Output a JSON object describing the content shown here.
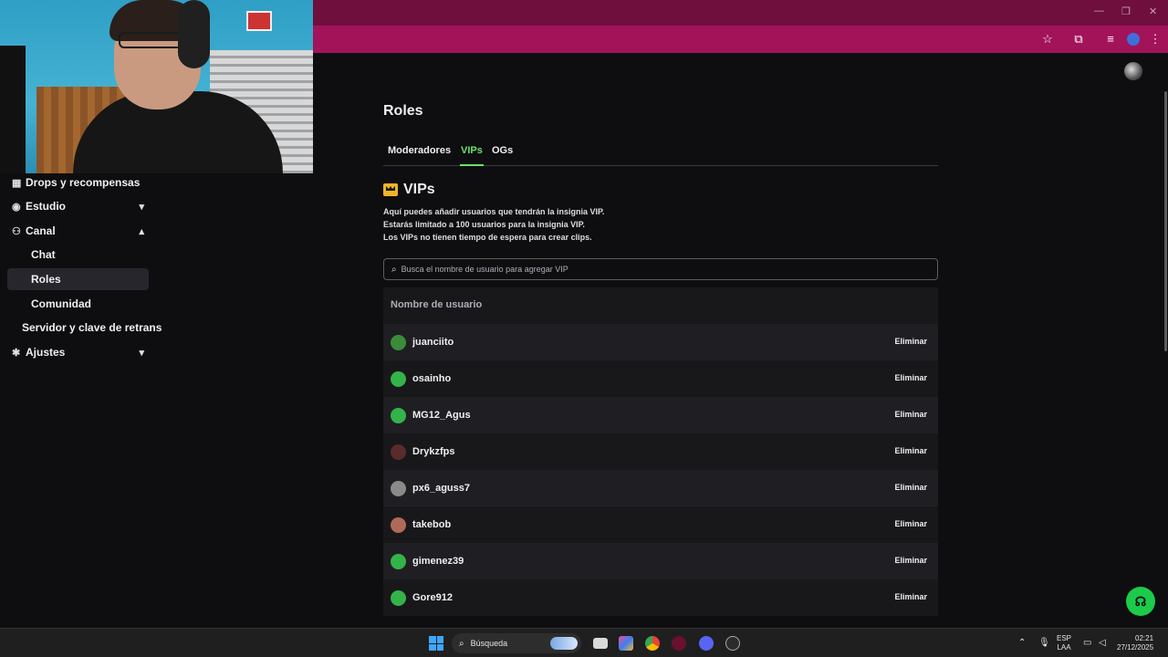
{
  "browser": {
    "window_controls": [
      "—",
      "❐",
      "✕"
    ],
    "toolbar_icons": [
      "bookmark-star-icon",
      "extensions-icon",
      "media-queue-icon",
      "profile-avatar-icon",
      "menu-dots-icon"
    ]
  },
  "sidebar": {
    "items": [
      {
        "label": "Drops y recompensas",
        "icon": "gift-icon",
        "chevron": ""
      },
      {
        "label": "Estudio",
        "icon": "studio-icon",
        "chevron": "⌄"
      },
      {
        "label": "Canal",
        "icon": "people-icon",
        "chevron": "⌃"
      },
      {
        "label": "Chat",
        "icon": "",
        "chevron": ""
      },
      {
        "label": "Roles",
        "icon": "",
        "chevron": "",
        "active": true
      },
      {
        "label": "Comunidad",
        "icon": "",
        "chevron": ""
      },
      {
        "label": "Servidor y clave de retrans",
        "icon": "",
        "chevron": ""
      },
      {
        "label": "Ajustes",
        "icon": "gear-icon",
        "chevron": "⌄"
      }
    ]
  },
  "main": {
    "title": "Roles",
    "tabs": [
      {
        "label": "Moderadores",
        "active": false
      },
      {
        "label": "VIPs",
        "active": true
      },
      {
        "label": "OGs",
        "active": false
      }
    ],
    "section_title": "VIPs",
    "description": [
      "Aquí puedes añadir usuarios que tendrán la insignia VIP.",
      "Estarás limitado a 100 usuarios para la insignia VIP.",
      "Los VIPs no tienen tiempo de espera para crear clips."
    ],
    "search_placeholder": "Busca el nombre de usuario para agregar VIP",
    "table_header": "Nombre de usuario",
    "remove_label": "Eliminar",
    "users": [
      {
        "name": "juanciito",
        "avatar_color": "#3a8c3a"
      },
      {
        "name": "osainho",
        "avatar_color": "#33b34a"
      },
      {
        "name": "MG12_Agus",
        "avatar_color": "#33b34a"
      },
      {
        "name": "Drykzfps",
        "avatar_color": "#5a2b2b"
      },
      {
        "name": "px6_aguss7",
        "avatar_color": "#8a8a8a"
      },
      {
        "name": "takebob",
        "avatar_color": "#b06a5a"
      },
      {
        "name": "gimenez39",
        "avatar_color": "#33b34a"
      },
      {
        "name": "Gore912",
        "avatar_color": "#33b34a"
      }
    ]
  },
  "help_icon": "help-headset-icon",
  "taskbar": {
    "search_label": "Búsqueda",
    "lang": "ESP",
    "lang_sub": "LAA",
    "time": "02:21",
    "date": "27/12/2025"
  },
  "colors": {
    "accent_green": "#69e36a",
    "browser_title": "#6f0f3d",
    "browser_toolbar": "#a2135a",
    "background": "#0e0e10"
  }
}
